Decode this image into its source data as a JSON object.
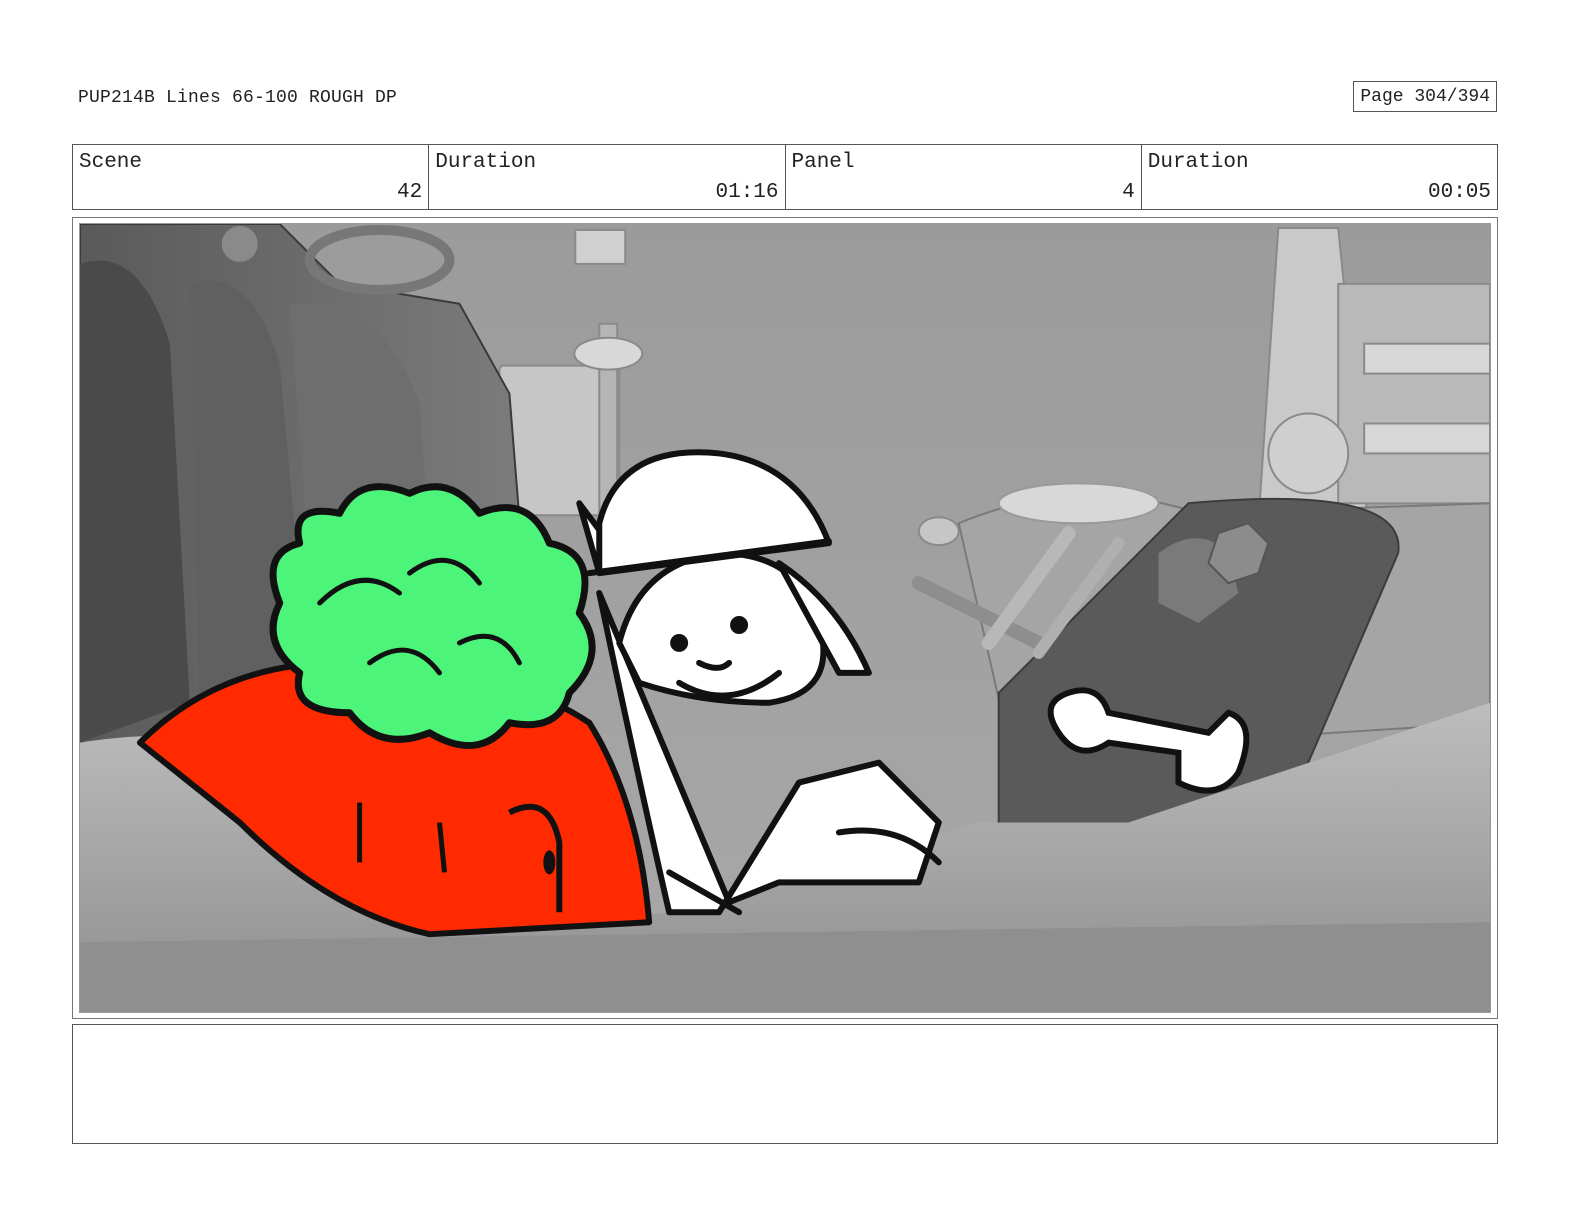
{
  "header": {
    "doc_title": "PUP214B Lines 66-100 ROUGH DP",
    "page_label": "Page 304/394"
  },
  "info": {
    "scene_label": "Scene",
    "scene_value": "42",
    "scene_duration_label": "Duration",
    "scene_duration_value": "01:16",
    "panel_label": "Panel",
    "panel_value": "4",
    "panel_duration_label": "Duration",
    "panel_duration_value": "00:05"
  },
  "notes": {
    "text": ""
  },
  "colors": {
    "bush_green": "#4cf57a",
    "pot_red": "#ff2a00",
    "background_gray": "#9a9a9a",
    "outline": "#111111"
  }
}
